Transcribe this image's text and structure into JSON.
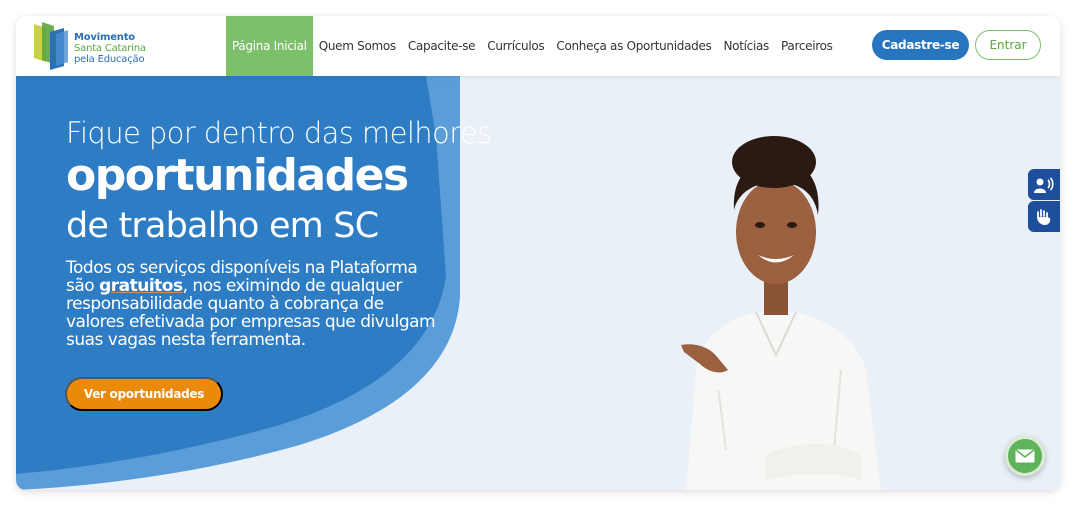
{
  "logo": {
    "line1": "Movimento",
    "line2": "Santa Catarina",
    "line3": "pela Educação",
    "colors": {
      "blue": "#2b6fb6",
      "green": "#5aa640",
      "yellow": "#d9d13a"
    }
  },
  "nav": {
    "items": [
      {
        "label": "Página Inicial",
        "active": true
      },
      {
        "label": "Quem Somos"
      },
      {
        "label": "Capacite-se"
      },
      {
        "label": "Currículos"
      },
      {
        "label": "Conheça as Oportunidades"
      },
      {
        "label": "Notícias"
      },
      {
        "label": "Parceiros"
      }
    ]
  },
  "header": {
    "cadastre_label": "Cadastre-se",
    "entrar_label": "Entrar"
  },
  "hero": {
    "line1": "Fique por dentro das melhores",
    "line2": "oportunidades",
    "line3": "de trabalho em SC",
    "desc_part1": "Todos os serviços disponíveis na Plataforma são ",
    "desc_bold": "gratuitos",
    "desc_part2": ", nos eximindo de qualquer responsabilidade quanto à cobrança de valores efetivada por empresas que divulgam suas vagas nesta ferramenta.",
    "cta_label": "Ver oportunidades"
  },
  "side_tools": {
    "items": [
      {
        "icon": "audio-description-icon"
      },
      {
        "icon": "sign-language-icon"
      }
    ]
  },
  "floating": {
    "icon": "mail-icon"
  },
  "colors": {
    "primary_blue": "#2775bf",
    "green": "#7cc169",
    "orange": "#e98a0b",
    "hero_blue": "#2e7dc4",
    "a11y_blue": "#1d4f9c"
  }
}
